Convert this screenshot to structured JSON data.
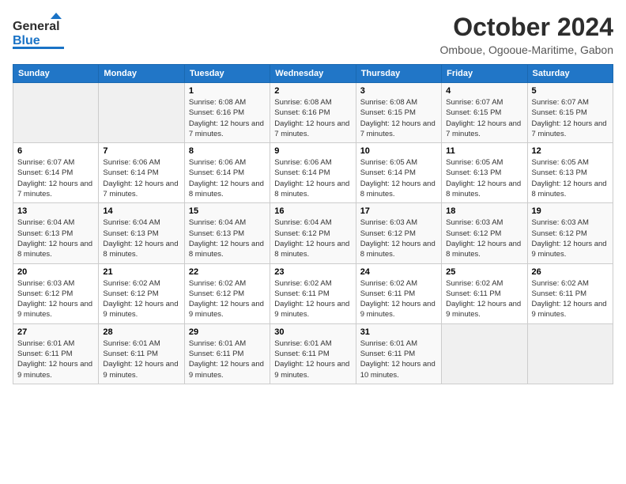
{
  "header": {
    "logo_general": "General",
    "logo_blue": "Blue",
    "month": "October 2024",
    "location": "Omboue, Ogooue-Maritime, Gabon"
  },
  "days_of_week": [
    "Sunday",
    "Monday",
    "Tuesday",
    "Wednesday",
    "Thursday",
    "Friday",
    "Saturday"
  ],
  "weeks": [
    [
      {
        "day": "",
        "sunrise": "",
        "sunset": "",
        "daylight": ""
      },
      {
        "day": "",
        "sunrise": "",
        "sunset": "",
        "daylight": ""
      },
      {
        "day": "1",
        "sunrise": "Sunrise: 6:08 AM",
        "sunset": "Sunset: 6:16 PM",
        "daylight": "Daylight: 12 hours and 7 minutes."
      },
      {
        "day": "2",
        "sunrise": "Sunrise: 6:08 AM",
        "sunset": "Sunset: 6:16 PM",
        "daylight": "Daylight: 12 hours and 7 minutes."
      },
      {
        "day": "3",
        "sunrise": "Sunrise: 6:08 AM",
        "sunset": "Sunset: 6:15 PM",
        "daylight": "Daylight: 12 hours and 7 minutes."
      },
      {
        "day": "4",
        "sunrise": "Sunrise: 6:07 AM",
        "sunset": "Sunset: 6:15 PM",
        "daylight": "Daylight: 12 hours and 7 minutes."
      },
      {
        "day": "5",
        "sunrise": "Sunrise: 6:07 AM",
        "sunset": "Sunset: 6:15 PM",
        "daylight": "Daylight: 12 hours and 7 minutes."
      }
    ],
    [
      {
        "day": "6",
        "sunrise": "Sunrise: 6:07 AM",
        "sunset": "Sunset: 6:14 PM",
        "daylight": "Daylight: 12 hours and 7 minutes."
      },
      {
        "day": "7",
        "sunrise": "Sunrise: 6:06 AM",
        "sunset": "Sunset: 6:14 PM",
        "daylight": "Daylight: 12 hours and 7 minutes."
      },
      {
        "day": "8",
        "sunrise": "Sunrise: 6:06 AM",
        "sunset": "Sunset: 6:14 PM",
        "daylight": "Daylight: 12 hours and 8 minutes."
      },
      {
        "day": "9",
        "sunrise": "Sunrise: 6:06 AM",
        "sunset": "Sunset: 6:14 PM",
        "daylight": "Daylight: 12 hours and 8 minutes."
      },
      {
        "day": "10",
        "sunrise": "Sunrise: 6:05 AM",
        "sunset": "Sunset: 6:14 PM",
        "daylight": "Daylight: 12 hours and 8 minutes."
      },
      {
        "day": "11",
        "sunrise": "Sunrise: 6:05 AM",
        "sunset": "Sunset: 6:13 PM",
        "daylight": "Daylight: 12 hours and 8 minutes."
      },
      {
        "day": "12",
        "sunrise": "Sunrise: 6:05 AM",
        "sunset": "Sunset: 6:13 PM",
        "daylight": "Daylight: 12 hours and 8 minutes."
      }
    ],
    [
      {
        "day": "13",
        "sunrise": "Sunrise: 6:04 AM",
        "sunset": "Sunset: 6:13 PM",
        "daylight": "Daylight: 12 hours and 8 minutes."
      },
      {
        "day": "14",
        "sunrise": "Sunrise: 6:04 AM",
        "sunset": "Sunset: 6:13 PM",
        "daylight": "Daylight: 12 hours and 8 minutes."
      },
      {
        "day": "15",
        "sunrise": "Sunrise: 6:04 AM",
        "sunset": "Sunset: 6:13 PM",
        "daylight": "Daylight: 12 hours and 8 minutes."
      },
      {
        "day": "16",
        "sunrise": "Sunrise: 6:04 AM",
        "sunset": "Sunset: 6:12 PM",
        "daylight": "Daylight: 12 hours and 8 minutes."
      },
      {
        "day": "17",
        "sunrise": "Sunrise: 6:03 AM",
        "sunset": "Sunset: 6:12 PM",
        "daylight": "Daylight: 12 hours and 8 minutes."
      },
      {
        "day": "18",
        "sunrise": "Sunrise: 6:03 AM",
        "sunset": "Sunset: 6:12 PM",
        "daylight": "Daylight: 12 hours and 8 minutes."
      },
      {
        "day": "19",
        "sunrise": "Sunrise: 6:03 AM",
        "sunset": "Sunset: 6:12 PM",
        "daylight": "Daylight: 12 hours and 9 minutes."
      }
    ],
    [
      {
        "day": "20",
        "sunrise": "Sunrise: 6:03 AM",
        "sunset": "Sunset: 6:12 PM",
        "daylight": "Daylight: 12 hours and 9 minutes."
      },
      {
        "day": "21",
        "sunrise": "Sunrise: 6:02 AM",
        "sunset": "Sunset: 6:12 PM",
        "daylight": "Daylight: 12 hours and 9 minutes."
      },
      {
        "day": "22",
        "sunrise": "Sunrise: 6:02 AM",
        "sunset": "Sunset: 6:12 PM",
        "daylight": "Daylight: 12 hours and 9 minutes."
      },
      {
        "day": "23",
        "sunrise": "Sunrise: 6:02 AM",
        "sunset": "Sunset: 6:11 PM",
        "daylight": "Daylight: 12 hours and 9 minutes."
      },
      {
        "day": "24",
        "sunrise": "Sunrise: 6:02 AM",
        "sunset": "Sunset: 6:11 PM",
        "daylight": "Daylight: 12 hours and 9 minutes."
      },
      {
        "day": "25",
        "sunrise": "Sunrise: 6:02 AM",
        "sunset": "Sunset: 6:11 PM",
        "daylight": "Daylight: 12 hours and 9 minutes."
      },
      {
        "day": "26",
        "sunrise": "Sunrise: 6:02 AM",
        "sunset": "Sunset: 6:11 PM",
        "daylight": "Daylight: 12 hours and 9 minutes."
      }
    ],
    [
      {
        "day": "27",
        "sunrise": "Sunrise: 6:01 AM",
        "sunset": "Sunset: 6:11 PM",
        "daylight": "Daylight: 12 hours and 9 minutes."
      },
      {
        "day": "28",
        "sunrise": "Sunrise: 6:01 AM",
        "sunset": "Sunset: 6:11 PM",
        "daylight": "Daylight: 12 hours and 9 minutes."
      },
      {
        "day": "29",
        "sunrise": "Sunrise: 6:01 AM",
        "sunset": "Sunset: 6:11 PM",
        "daylight": "Daylight: 12 hours and 9 minutes."
      },
      {
        "day": "30",
        "sunrise": "Sunrise: 6:01 AM",
        "sunset": "Sunset: 6:11 PM",
        "daylight": "Daylight: 12 hours and 9 minutes."
      },
      {
        "day": "31",
        "sunrise": "Sunrise: 6:01 AM",
        "sunset": "Sunset: 6:11 PM",
        "daylight": "Daylight: 12 hours and 10 minutes."
      },
      {
        "day": "",
        "sunrise": "",
        "sunset": "",
        "daylight": ""
      },
      {
        "day": "",
        "sunrise": "",
        "sunset": "",
        "daylight": ""
      }
    ]
  ]
}
